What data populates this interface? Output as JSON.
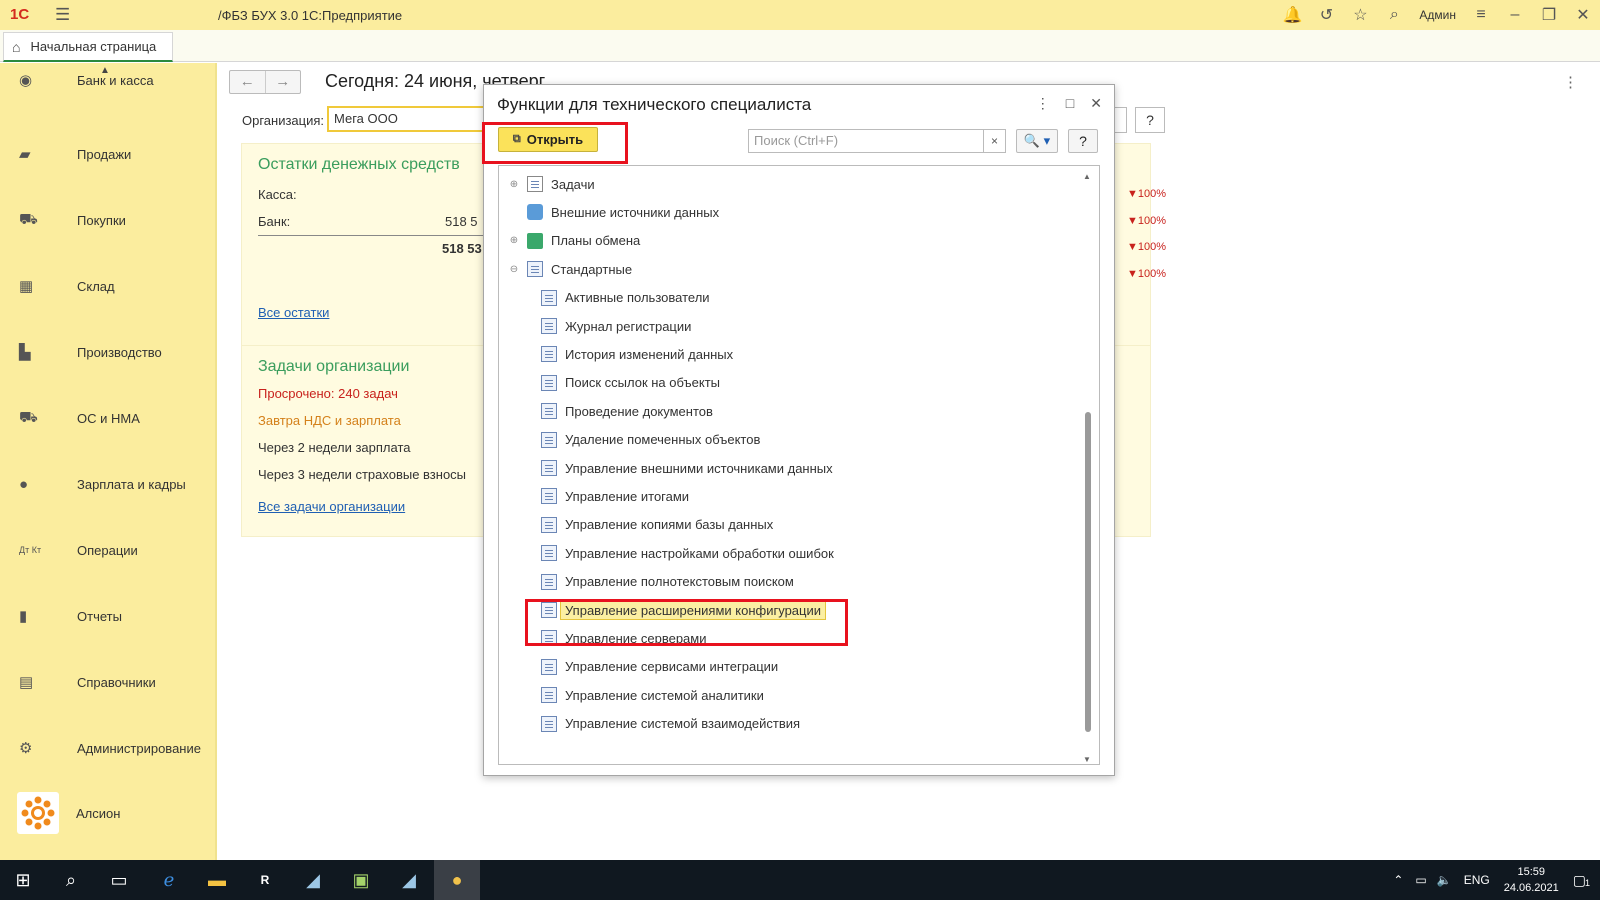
{
  "window": {
    "logo": "1С",
    "title": "/ФБЗ БУХ 3.0 1С:Предприятие",
    "user": "Админ"
  },
  "tabs": [
    {
      "label": "Начальная страница"
    }
  ],
  "sidebar": {
    "items": [
      {
        "label": "Банк и касса",
        "icon": "bank-icon"
      },
      {
        "label": "Продажи",
        "icon": "bag-icon"
      },
      {
        "label": "Покупки",
        "icon": "cart-icon"
      },
      {
        "label": "Склад",
        "icon": "warehouse-icon"
      },
      {
        "label": "Производство",
        "icon": "factory-icon"
      },
      {
        "label": "ОС и НМА",
        "icon": "truck-icon"
      },
      {
        "label": "Зарплата и кадры",
        "icon": "person-icon"
      },
      {
        "label": "Операции",
        "icon": "dt-kt-icon"
      },
      {
        "label": "Отчеты",
        "icon": "bar-chart-icon"
      },
      {
        "label": "Справочники",
        "icon": "book-icon"
      },
      {
        "label": "Администрирование",
        "icon": "gear-icon"
      },
      {
        "label": "Алсион",
        "icon": "alcion-logo"
      }
    ]
  },
  "main": {
    "today": "Сегодня: 24 июня, четверг",
    "org_label": "Организация:",
    "org_value": "Мега ООО",
    "help": "?",
    "cash": {
      "title": "Остатки денежных средств",
      "kassa_label": "Касса:",
      "bank_label": "Банк:",
      "bank_value": "518 5",
      "total_value": "518 53",
      "link": "Все остатки"
    },
    "tasks": {
      "title": "Задачи организации",
      "overdue": "Просрочено: 240 задач",
      "tomorrow": "Завтра НДС и зарплата",
      "two_weeks": "Через 2 недели зарплата",
      "three_weeks": "Через 3 недели страховые взносы",
      "link": "Все задачи организации"
    },
    "percents": [
      "▼100%",
      "▼100%",
      "▼100%",
      "▼100%"
    ]
  },
  "modal": {
    "title": "Функции для технического специалиста",
    "open_button": "Открыть",
    "search_placeholder": "Поиск (Ctrl+F)",
    "search_clear": "×",
    "search_button": "🔍 ▾",
    "help": "?",
    "tree": [
      {
        "label": "Задачи",
        "level": 0,
        "expander": "⊕",
        "icon": "doc"
      },
      {
        "label": "Внешние источники данных",
        "level": 0,
        "expander": "",
        "icon": "ext"
      },
      {
        "label": "Планы обмена",
        "level": 0,
        "expander": "⊕",
        "icon": "plan"
      },
      {
        "label": "Стандартные",
        "level": 0,
        "expander": "⊖",
        "icon": "form"
      },
      {
        "label": "Активные пользователи",
        "level": 1,
        "icon": "form"
      },
      {
        "label": "Журнал регистрации",
        "level": 1,
        "icon": "form"
      },
      {
        "label": "История изменений данных",
        "level": 1,
        "icon": "form"
      },
      {
        "label": "Поиск ссылок на объекты",
        "level": 1,
        "icon": "form"
      },
      {
        "label": "Проведение документов",
        "level": 1,
        "icon": "form"
      },
      {
        "label": "Удаление помеченных объектов",
        "level": 1,
        "icon": "form"
      },
      {
        "label": "Управление внешними источниками данных",
        "level": 1,
        "icon": "form"
      },
      {
        "label": "Управление итогами",
        "level": 1,
        "icon": "form"
      },
      {
        "label": "Управление копиями базы данных",
        "level": 1,
        "icon": "form"
      },
      {
        "label": "Управление настройками обработки ошибок",
        "level": 1,
        "icon": "form"
      },
      {
        "label": "Управление полнотекстовым поиском",
        "level": 1,
        "icon": "form"
      },
      {
        "label": "Управление расширениями конфигурации",
        "level": 1,
        "icon": "form",
        "selected": true
      },
      {
        "label": "Управление серверами",
        "level": 1,
        "icon": "form"
      },
      {
        "label": "Управление сервисами интеграции",
        "level": 1,
        "icon": "form"
      },
      {
        "label": "Управление системой аналитики",
        "level": 1,
        "icon": "form"
      },
      {
        "label": "Управление системой взаимодействия",
        "level": 1,
        "icon": "form"
      }
    ]
  },
  "taskbar": {
    "lang": "ENG",
    "time": "15:59",
    "date": "24.06.2021",
    "notif_count": "1"
  }
}
